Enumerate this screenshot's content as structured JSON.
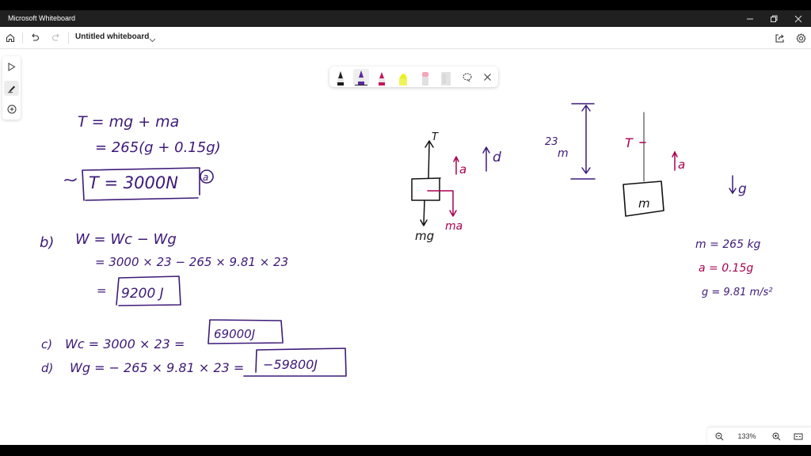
{
  "window": {
    "title": "Microsoft Whiteboard",
    "controls": [
      "minimize",
      "restore",
      "close"
    ]
  },
  "appbar": {
    "home_icon": "home-icon",
    "undo_icon": "undo-icon",
    "redo_icon": "redo-icon",
    "document_title": "Untitled whiteboard",
    "title_dropdown_icon": "chevron-down-icon",
    "share_icon": "share-icon",
    "settings_icon": "gear-icon"
  },
  "left_toolbar": {
    "items": [
      {
        "name": "select",
        "icon": "pointer-icon",
        "active": false
      },
      {
        "name": "ink",
        "icon": "pen-icon",
        "active": true
      },
      {
        "name": "add",
        "icon": "plus-circle-icon",
        "active": false
      }
    ]
  },
  "pen_tray": {
    "pens": [
      {
        "name": "black-pen",
        "color": "#1a1a1a",
        "active": false
      },
      {
        "name": "purple-pen",
        "color": "#5b2a9c",
        "active": true
      },
      {
        "name": "magenta-pen",
        "color": "#c2185b",
        "active": false
      },
      {
        "name": "yellow-highlighter",
        "color": "#e8f020",
        "active": false
      },
      {
        "name": "eraser",
        "color": "#f4a6b8",
        "active": false
      },
      {
        "name": "ruler",
        "color": "#d8d8d8",
        "active": false
      }
    ],
    "lasso_icon": "lasso-icon",
    "close_icon": "close-icon"
  },
  "zoom_controls": {
    "zoom_out_icon": "zoom-out-icon",
    "zoom_level": "133%",
    "zoom_in_icon": "zoom-in-icon",
    "fit_icon": "fit-to-screen-icon"
  },
  "ink_colors": {
    "purple": "#3d1a78",
    "magenta": "#a8004f",
    "black": "#111111"
  },
  "board": {
    "part_a": {
      "line1": "T = mg + ma",
      "line2": "= 265(g + 0.15g)",
      "answer": "T = 3000N",
      "tag": "a"
    },
    "part_b": {
      "label": "b)",
      "line1": "W = Wc − Wg",
      "line2": "= 3000 × 23  −  265 × 9.81 × 23",
      "answer": "9200 J"
    },
    "part_c": {
      "label": "c)",
      "line": "Wc = 3000 × 23 =",
      "answer": "69000J"
    },
    "part_d": {
      "label": "d)",
      "line": "Wg = − 265 × 9.81 × 23 =",
      "answer": "−59800J"
    },
    "fbd": {
      "tension": "T",
      "weight": "mg",
      "inertial": "ma",
      "accel": "a",
      "displacement": "d"
    },
    "scene": {
      "height": "23",
      "height_unit": "m",
      "tension": "T",
      "accel": "a",
      "mass": "m",
      "gravity": "g"
    },
    "givens": {
      "mass": "m = 265 kg",
      "accel": "a = 0.15g",
      "gravity": "g = 9.81 m/s²"
    }
  }
}
